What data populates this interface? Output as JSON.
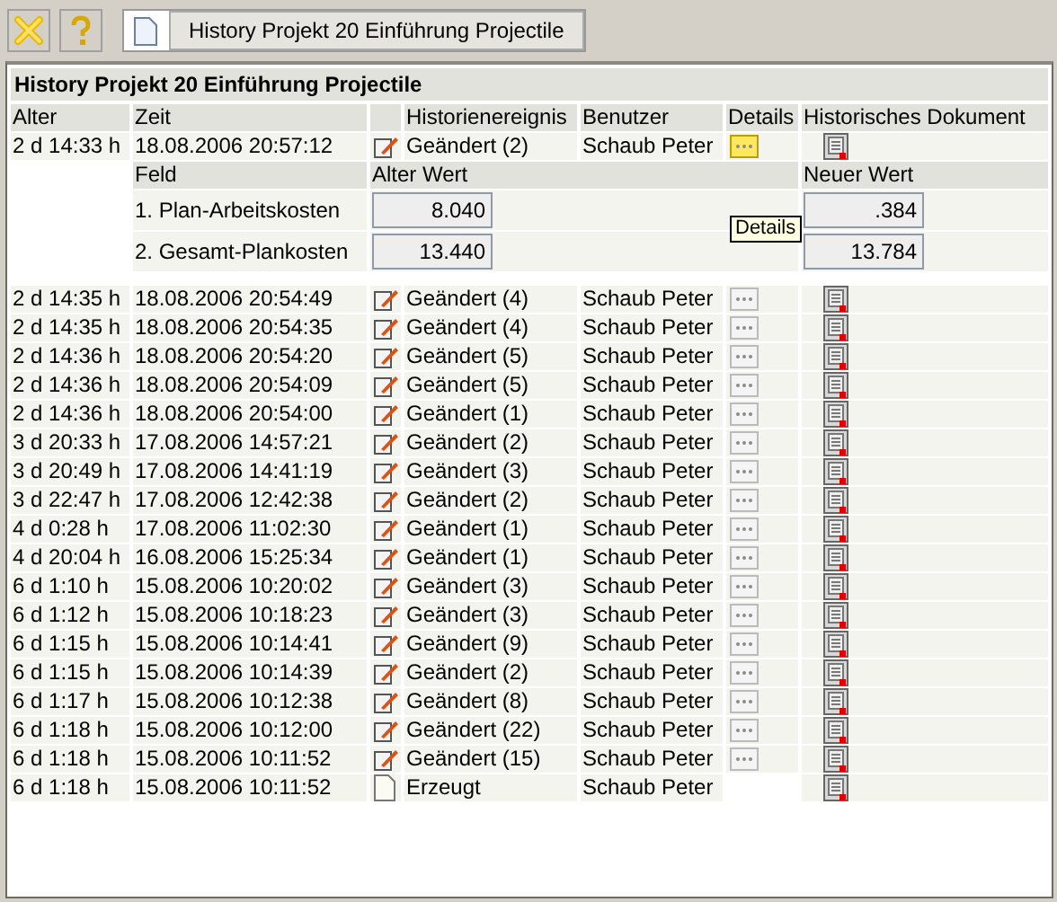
{
  "toolbar": {
    "tab": {
      "label": "History Projekt 20 Einführung Projectile"
    }
  },
  "panel": {
    "title": "History Projekt 20 Einführung Projectile",
    "columns": [
      "Alter",
      "Zeit",
      "Historienereignis",
      "Benutzer",
      "Details",
      "Historisches Dokument"
    ],
    "rows": [
      {
        "age": "2 d 14:33 h",
        "time": "18.08.2006 20:57:12",
        "kind": "changed",
        "event": "Geändert (2)",
        "user": "Schaub Peter",
        "details": true,
        "details_hovered": true,
        "detail": {
          "columns": [
            "Feld",
            "Alter Wert",
            "Neuer Wert"
          ],
          "fields": [
            {
              "name": "1. Plan-Arbeitskosten",
              "old": "8.040",
              "new": ".384"
            },
            {
              "name": "2. Gesamt-Plankosten",
              "old": "13.440",
              "new": "13.784"
            }
          ]
        },
        "tooltip": "Details"
      },
      {
        "age": "2 d 14:35 h",
        "time": "18.08.2006 20:54:49",
        "kind": "changed",
        "event": "Geändert (4)",
        "user": "Schaub Peter",
        "details": true,
        "details_hovered": false
      },
      {
        "age": "2 d 14:35 h",
        "time": "18.08.2006 20:54:35",
        "kind": "changed",
        "event": "Geändert (4)",
        "user": "Schaub Peter",
        "details": true,
        "details_hovered": false
      },
      {
        "age": "2 d 14:36 h",
        "time": "18.08.2006 20:54:20",
        "kind": "changed",
        "event": "Geändert (5)",
        "user": "Schaub Peter",
        "details": true,
        "details_hovered": false
      },
      {
        "age": "2 d 14:36 h",
        "time": "18.08.2006 20:54:09",
        "kind": "changed",
        "event": "Geändert (5)",
        "user": "Schaub Peter",
        "details": true,
        "details_hovered": false
      },
      {
        "age": "2 d 14:36 h",
        "time": "18.08.2006 20:54:00",
        "kind": "changed",
        "event": "Geändert (1)",
        "user": "Schaub Peter",
        "details": true,
        "details_hovered": false
      },
      {
        "age": "3 d 20:33 h",
        "time": "17.08.2006 14:57:21",
        "kind": "changed",
        "event": "Geändert (2)",
        "user": "Schaub Peter",
        "details": true,
        "details_hovered": false
      },
      {
        "age": "3 d 20:49 h",
        "time": "17.08.2006 14:41:19",
        "kind": "changed",
        "event": "Geändert (3)",
        "user": "Schaub Peter",
        "details": true,
        "details_hovered": false
      },
      {
        "age": "3 d 22:47 h",
        "time": "17.08.2006 12:42:38",
        "kind": "changed",
        "event": "Geändert (2)",
        "user": "Schaub Peter",
        "details": true,
        "details_hovered": false
      },
      {
        "age": "4 d 0:28 h",
        "time": "17.08.2006 11:02:30",
        "kind": "changed",
        "event": "Geändert (1)",
        "user": "Schaub Peter",
        "details": true,
        "details_hovered": false
      },
      {
        "age": "4 d 20:04 h",
        "time": "16.08.2006 15:25:34",
        "kind": "changed",
        "event": "Geändert (1)",
        "user": "Schaub Peter",
        "details": true,
        "details_hovered": false
      },
      {
        "age": "6 d 1:10 h",
        "time": "15.08.2006 10:20:02",
        "kind": "changed",
        "event": "Geändert (3)",
        "user": "Schaub Peter",
        "details": true,
        "details_hovered": false
      },
      {
        "age": "6 d 1:12 h",
        "time": "15.08.2006 10:18:23",
        "kind": "changed",
        "event": "Geändert (3)",
        "user": "Schaub Peter",
        "details": true,
        "details_hovered": false
      },
      {
        "age": "6 d 1:15 h",
        "time": "15.08.2006 10:14:41",
        "kind": "changed",
        "event": "Geändert (9)",
        "user": "Schaub Peter",
        "details": true,
        "details_hovered": false
      },
      {
        "age": "6 d 1:15 h",
        "time": "15.08.2006 10:14:39",
        "kind": "changed",
        "event": "Geändert (2)",
        "user": "Schaub Peter",
        "details": true,
        "details_hovered": false
      },
      {
        "age": "6 d 1:17 h",
        "time": "15.08.2006 10:12:38",
        "kind": "changed",
        "event": "Geändert (8)",
        "user": "Schaub Peter",
        "details": true,
        "details_hovered": false
      },
      {
        "age": "6 d 1:18 h",
        "time": "15.08.2006 10:12:00",
        "kind": "changed",
        "event": "Geändert (22)",
        "user": "Schaub Peter",
        "details": true,
        "details_hovered": false
      },
      {
        "age": "6 d 1:18 h",
        "time": "15.08.2006 10:11:52",
        "kind": "changed",
        "event": "Geändert (15)",
        "user": "Schaub Peter",
        "details": true,
        "details_hovered": false
      },
      {
        "age": "6 d 1:18 h",
        "time": "15.08.2006 10:11:52",
        "kind": "created",
        "event": "Erzeugt",
        "user": "Schaub Peter",
        "details": false
      }
    ]
  }
}
